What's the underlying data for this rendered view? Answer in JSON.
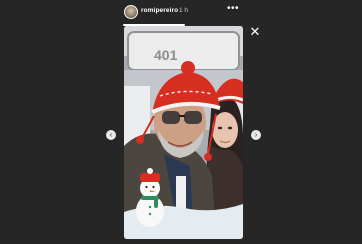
{
  "story": {
    "username": "romipereiro",
    "time_ago": "1 h",
    "progress": 1,
    "sign_number": "401",
    "more_label": "•••",
    "close_label": "✕",
    "prev_label": "‹",
    "next_label": "›"
  },
  "colors": {
    "background": "#262626",
    "hat_red": "#d72e22",
    "white": "#ffffff"
  },
  "icons": {
    "more": "more-options-icon",
    "close": "close-icon",
    "prev": "chevron-left-icon",
    "next": "chevron-right-icon"
  }
}
